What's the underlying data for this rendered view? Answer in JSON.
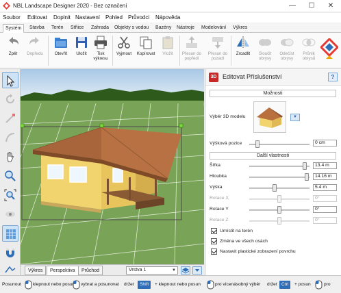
{
  "window": {
    "title": "NBL Landscape Designer 2020 - Bez označení",
    "minimize": "—",
    "maximize": "☐",
    "close": "✕"
  },
  "menu": [
    "Soubor",
    "Editovat",
    "Doplnit",
    "Nastavení",
    "Pohled",
    "Průvodci",
    "Nápověda"
  ],
  "ribbon_tabs": [
    "Systém",
    "Stavba",
    "Terén",
    "Střiice",
    "Zahrada",
    "Objekty s vodou",
    "Bazény",
    "Nástroje",
    "Modelování",
    "Výkres"
  ],
  "ribbon": {
    "zpet": "Zpět",
    "dopredu": "Dopředu",
    "otevrit": "Otevřít",
    "ulozit": "Uložit",
    "tisk1": "Tisk",
    "tisk2": "výkresu",
    "vyjmout": "Vyjmout",
    "kopirovat": "Kopírovat",
    "vlozit": "Vložit",
    "presun1a": "Přesun do",
    "presun1b": "popředí",
    "presun2a": "Přesun do",
    "presun2b": "pozadí",
    "zrcadlit": "Zrcadlit",
    "sloucit1": "Sloučit",
    "sloucit2": "obrysy",
    "odecist1": "Odečíst",
    "odecist2": "obrysy",
    "prunik1": "Průnik",
    "prunik2": "obrysů"
  },
  "viewport_tabs": [
    "Výkres",
    "Perspektiva",
    "Průchod"
  ],
  "layer": "Vrstva 1",
  "panel": {
    "title": "Editovat Příslušenství",
    "help": "?",
    "moznosti": "Možnosti",
    "vyber3d": "Výběr 3D modelu",
    "vyskova_pozice": "Výšková pozice",
    "vyskova_value": "0 cm",
    "dalsi": "Další vlastnosti",
    "props": [
      {
        "label": "Šířka",
        "value": "13.4 m",
        "level": 0.92,
        "enabled": true
      },
      {
        "label": "Hloubka",
        "value": "14.16 m",
        "level": 0.95,
        "enabled": true
      },
      {
        "label": "Výška",
        "value": "5.4 m",
        "level": 0.42,
        "enabled": true
      },
      {
        "label": "Rotace X",
        "value": "0°",
        "level": 0.5,
        "enabled": false
      },
      {
        "label": "Rotace Y",
        "value": "0°",
        "level": 0.5,
        "enabled": true
      },
      {
        "label": "Rotace Z",
        "value": "0°",
        "level": 0.5,
        "enabled": false
      }
    ],
    "checks": [
      "Umístit na terén",
      "Změna ve všech osách",
      "Nastavit plastické zobrazení povrchu"
    ]
  },
  "status": {
    "posunout": "Posunout",
    "t1": "klepnout nebo posun",
    "t2": "vybrat a posunovat",
    "drzet": "držet",
    "shift": "Shift",
    "t3": "+ klepnout nebo posun",
    "t4": "pro vícenásobný výběr",
    "ctrl": "Ctrl",
    "t5": "+ posun",
    "t6": "pro"
  }
}
